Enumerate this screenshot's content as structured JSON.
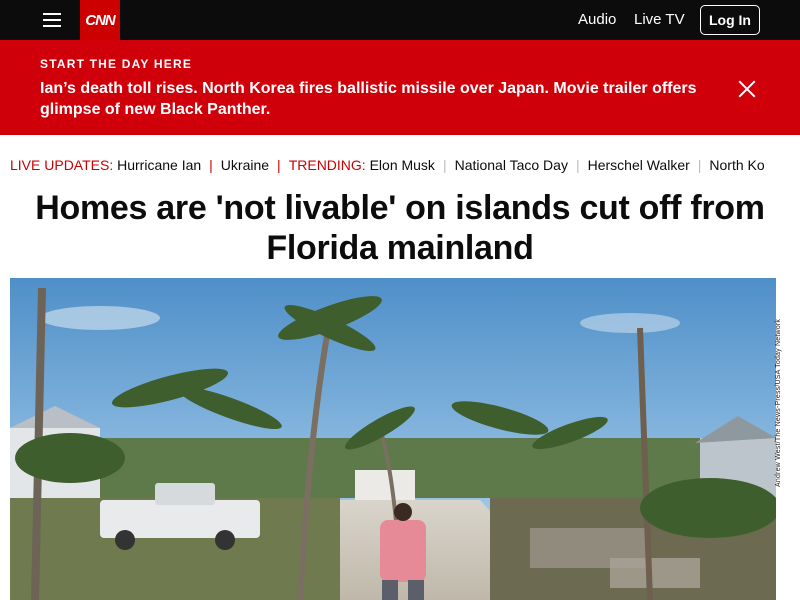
{
  "header": {
    "logo_text": "CNN",
    "links": [
      "Audio",
      "Live TV"
    ],
    "login_label": "Log In"
  },
  "banner": {
    "kicker": "START THE DAY HERE",
    "text": "Ian’s death toll rises. North Korea fires ballistic missile over Japan. Movie trailer offers glimpse of new Black Panther."
  },
  "trending": {
    "live_label": "LIVE UPDATES:",
    "live_item": "Hurricane Ian",
    "item_ukraine": "Ukraine",
    "trending_label": "TRENDING:",
    "trending_items": [
      "Elon Musk",
      "National Taco Day",
      "Herschel Walker",
      "North Ko"
    ]
  },
  "article": {
    "headline": "Homes are 'not livable' on islands cut off from Florida mainland",
    "image_credit": "Andrew West/The News-Press/USA Today Network"
  },
  "colors": {
    "brand_red": "#cc0000",
    "banner_red": "#d0000a",
    "nav_bg": "#0c0c0c"
  },
  "icons": [
    "menu-icon",
    "close-icon"
  ]
}
